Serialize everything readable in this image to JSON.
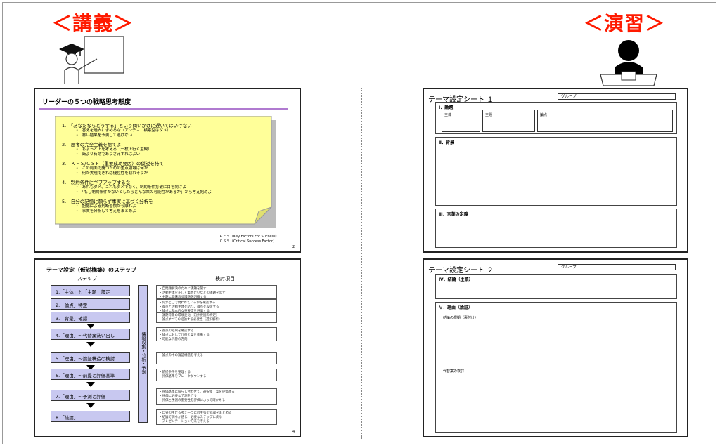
{
  "lecture": {
    "label": "＜講義＞",
    "slide1": {
      "title": "リーダーの５つの戦略思考態度",
      "items": [
        {
          "head": "1.　「あなたならどうする」という問いかけに遅いてはいけない",
          "subs": [
            "•　答えを過去に求めるな（アンチョコ横索型はダメ）",
            "•　悪い結果を予測して逃げない"
          ]
        },
        {
          "head": "2.　思考の完全主義を捨てよ",
          "subs": [
            "•　ちょっと上を考える（一枚上行く主観）",
            "•　厳より有効でありさえすればよい"
          ]
        },
        {
          "head": "3.　ＫＦＳ/ＣＳＦ（重要成功要因）の仮説を持て",
          "subs": [
            "•　この局面で勝つための重点領域は何か",
            "•　何が実現できれば優位性を取れそうか"
          ]
        },
        {
          "head": "4.　制約条件にギブアップするな",
          "subs": [
            "•　あれもダメ、これもダメでなく、制約条件打破に目を向けよ",
            "•　「もし制約条件がないとしたらどんな策の可能性があるか」から考え始めよ"
          ]
        },
        {
          "head": "5.　自分の記憶に頼らず事実に基づく分析を",
          "subs": [
            "•　記憶による判断習慣から離れよ",
            "•　事実を分析して考えをまとめよ"
          ]
        }
      ],
      "footnote1": "ＫＦＳ（Key Factors For Success）",
      "footnote2": "ＣＳＳ（Critical Success Factor）",
      "page": "2"
    },
    "slide2": {
      "title": "テーマ設定（仮説構築）のステップ",
      "col_steps": "ステップ",
      "col_items": "検討項目",
      "side_label": "情報収集・分析・予測",
      "steps": [
        "1.「主体」と「主題」設定",
        "2.　論点」特定",
        "3.　背景」確認",
        "4.「理由」～代替案洗い出し",
        "5.「理由」～論証構造の検討",
        "6.「理由」～前提と評価基準",
        "7.「理由」～予測と評価",
        "8.「結論」"
      ],
      "descs": [
        "・自間題解決のために課題を聞す\n・活動主体を正しく集めたいなどの課題を示す\n・主題に意味ある課題を明確する",
        "・何がどこで問われているかを確認する\n・論点と活動主体を結び、論点を設定する\n・論点に基本的な重要度を評価する",
        "・議題背景の環境変化（内外要因の特定）\n・論点すべての結論する必要性（選択解析）",
        "・論点の結果を確認する\n・論点に対して代替え案を準備する\n・可能な代替の方向",
        "・論点の中の論証構造を考える",
        "・前提条件を整理する\n・評価基準をブレークダウンする",
        "・評価基準に照らし合わせて、選択肢・案を評価する\n・評価に必要な予測を行う\n・評価と予測の重要性を評価によって確かめる",
        "・自分の主たる考え一つにの主張で結論をまとめる\n・結論で明らか感じ、必要なステップに戻る\n・プレゼンテーション方法を考える"
      ],
      "page": "4"
    }
  },
  "exercise": {
    "label": "＜演習＞",
    "sheet1": {
      "title": "テーマ設定シート １",
      "group": "グループ",
      "sec1": "Ⅰ．論題",
      "cells": [
        "主体",
        "主題",
        "論点"
      ],
      "sec2": "Ⅱ．背景",
      "sec3": "Ⅲ．言葉の定義"
    },
    "sheet2": {
      "title": "テーマ設定シート ２",
      "group": "グループ",
      "sec4": "Ⅳ．結論（主張）",
      "sec5": "Ｖ．理由（論証）",
      "note1": "結論の根拠（裏付け）",
      "note2": "代替案の検討"
    }
  },
  "colors": {
    "header_red": "#ff1a00",
    "note_yellow": "#ffff99",
    "step_lavender": "#c8c8f0"
  }
}
